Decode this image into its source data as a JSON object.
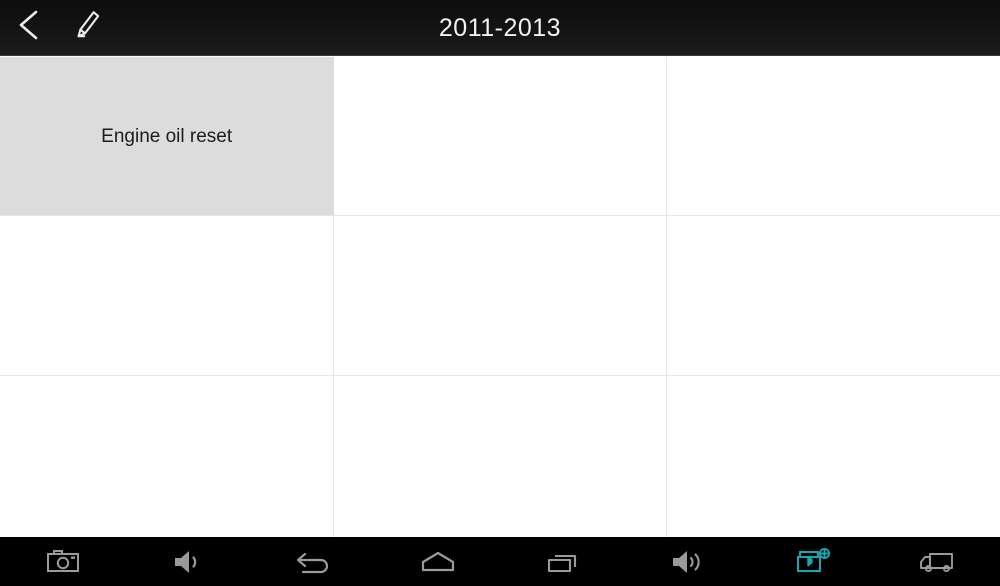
{
  "window": {
    "title": "2011-2013",
    "background": "#ffffff"
  },
  "header": {
    "title": "2011-2013",
    "background": "#101010",
    "text_color": "#f2f2f2",
    "buttons": [
      {
        "name": "back-button",
        "icon": "chevron-left-icon",
        "label": "Back"
      },
      {
        "name": "edit-button",
        "icon": "pencil-icon",
        "label": "Edit"
      }
    ]
  },
  "menu_grid": {
    "columns": 3,
    "rows": 3,
    "selected_index": 0,
    "selected_background": "#dcdcdc",
    "grid_line_color": "#e6e6e6",
    "cells": [
      {
        "label": "Engine oil reset",
        "filled": true
      },
      {
        "label": "",
        "filled": false
      },
      {
        "label": "",
        "filled": false
      },
      {
        "label": "",
        "filled": false
      },
      {
        "label": "",
        "filled": false
      },
      {
        "label": "",
        "filled": false
      },
      {
        "label": "",
        "filled": false
      },
      {
        "label": "",
        "filled": false
      },
      {
        "label": "",
        "filled": false
      }
    ]
  },
  "navbar": {
    "background": "#000000",
    "icon_color": "#9a9a9a",
    "accent_color": "#17a8b8",
    "items": [
      {
        "name": "screenshot-button",
        "icon": "camera-icon",
        "label": "Screenshot",
        "active": false
      },
      {
        "name": "volume-down-button",
        "icon": "volume-down-icon",
        "label": "Volume down",
        "active": false
      },
      {
        "name": "back-nav-button",
        "icon": "back-arrow-icon",
        "label": "Back",
        "active": false
      },
      {
        "name": "home-nav-button",
        "icon": "home-icon",
        "label": "Home",
        "active": false
      },
      {
        "name": "recents-nav-button",
        "icon": "recent-apps-icon",
        "label": "Recent apps",
        "active": false
      },
      {
        "name": "volume-up-button",
        "icon": "volume-up-icon",
        "label": "Volume up",
        "active": false
      },
      {
        "name": "vci-bluetooth-button",
        "icon": "obd-bluetooth-icon",
        "label": "VCI Bluetooth",
        "active": true
      },
      {
        "name": "vehicle-button",
        "icon": "truck-icon",
        "label": "Vehicle",
        "active": false
      }
    ]
  }
}
